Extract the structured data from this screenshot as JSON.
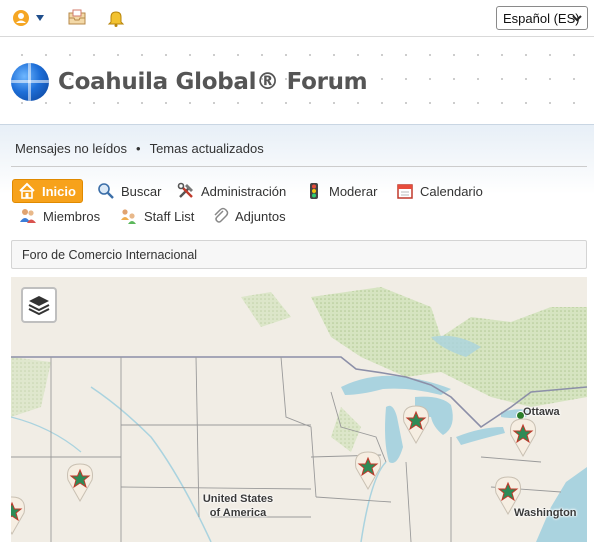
{
  "topbar": {
    "icons": [
      "user-menu-icon",
      "chevron-down-icon",
      "inbox-icon",
      "notification-bell-icon"
    ],
    "language_select": {
      "value": "Español (ES)"
    }
  },
  "header": {
    "site_title": "Coahuila Global® Forum",
    "logo_icon": "globe-logo-icon"
  },
  "quicklinks": {
    "unread": "Mensajes no leídos",
    "separator": "•",
    "updated": "Temas actualizados"
  },
  "nav": {
    "items": [
      {
        "label": "Inicio",
        "icon": "home-icon",
        "active": true
      },
      {
        "label": "Buscar",
        "icon": "search-icon"
      },
      {
        "label": "Administración",
        "icon": "tools-icon"
      },
      {
        "label": "Moderar",
        "icon": "traffic-light-icon"
      },
      {
        "label": "Calendario",
        "icon": "calendar-icon"
      },
      {
        "label": "Miembros",
        "icon": "members-icon"
      },
      {
        "label": "Staff List",
        "icon": "staff-icon"
      },
      {
        "label": "Adjuntos",
        "icon": "paperclip-icon"
      }
    ]
  },
  "breadcrumb": {
    "label": "Foro de Comercio Internacional"
  },
  "map": {
    "layers_button_icon": "layers-icon",
    "labels": {
      "country_line1": "United States",
      "country_line2": "of America",
      "ottawa": "Ottawa",
      "washington": "Washington"
    },
    "colors": {
      "land": "#f1ede5",
      "water": "#aad3df",
      "forest": "#c8dcb0",
      "border": "#8a8a8a"
    }
  },
  "colors": {
    "accent": "#f7a21b",
    "title": "#555555"
  }
}
